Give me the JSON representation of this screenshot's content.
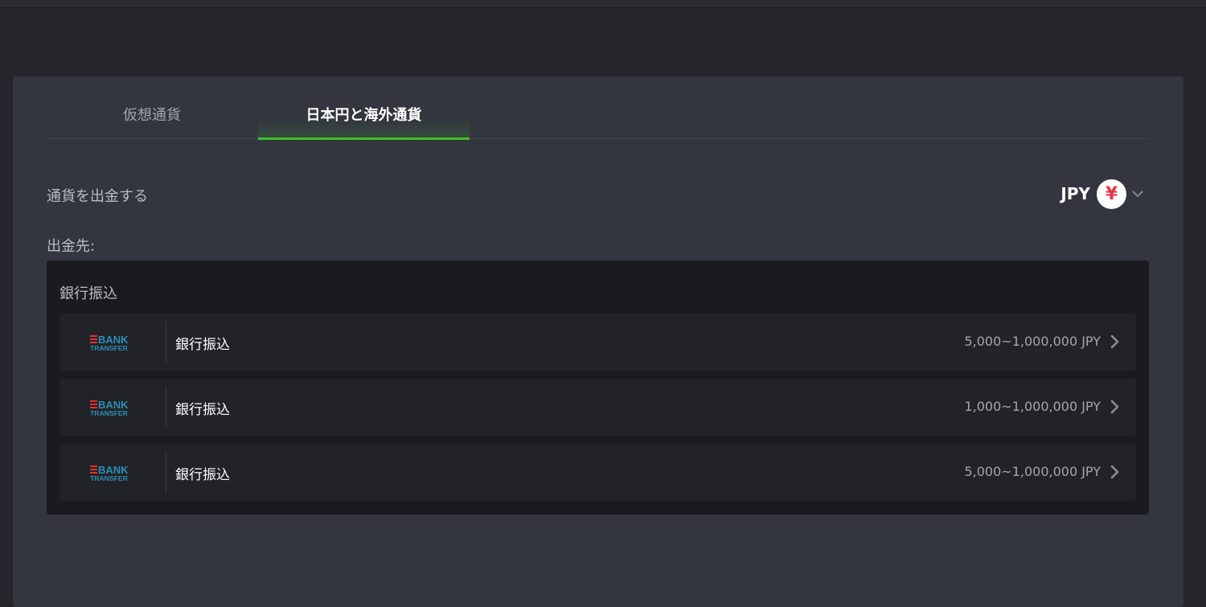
{
  "tabs": [
    {
      "label": "仮想通貨",
      "active": false
    },
    {
      "label": "日本円と海外通貨",
      "active": true
    }
  ],
  "withdraw": {
    "label": "通貨を出金する",
    "currency_code": "JPY",
    "currency_symbol": "¥",
    "currency_icon": "yen-icon"
  },
  "destination_label": "出金先:",
  "methods_group": {
    "title": "銀行振込",
    "items": [
      {
        "logo_top": "BANK",
        "logo_bottom": "TRANSFER",
        "name": "銀行振込",
        "range": "5,000~1,000,000 JPY"
      },
      {
        "logo_top": "BANK",
        "logo_bottom": "TRANSFER",
        "name": "銀行振込",
        "range": "1,000~1,000,000 JPY"
      },
      {
        "logo_top": "BANK",
        "logo_bottom": "TRANSFER",
        "name": "銀行振込",
        "range": "5,000~1,000,000 JPY"
      }
    ]
  },
  "colors": {
    "background": "#25262c",
    "panel": "#33353f",
    "accent_green": "#3ec02c",
    "logo_red": "#e5302f",
    "logo_blue": "#2a8fb8",
    "yen_red": "#e8364a"
  }
}
